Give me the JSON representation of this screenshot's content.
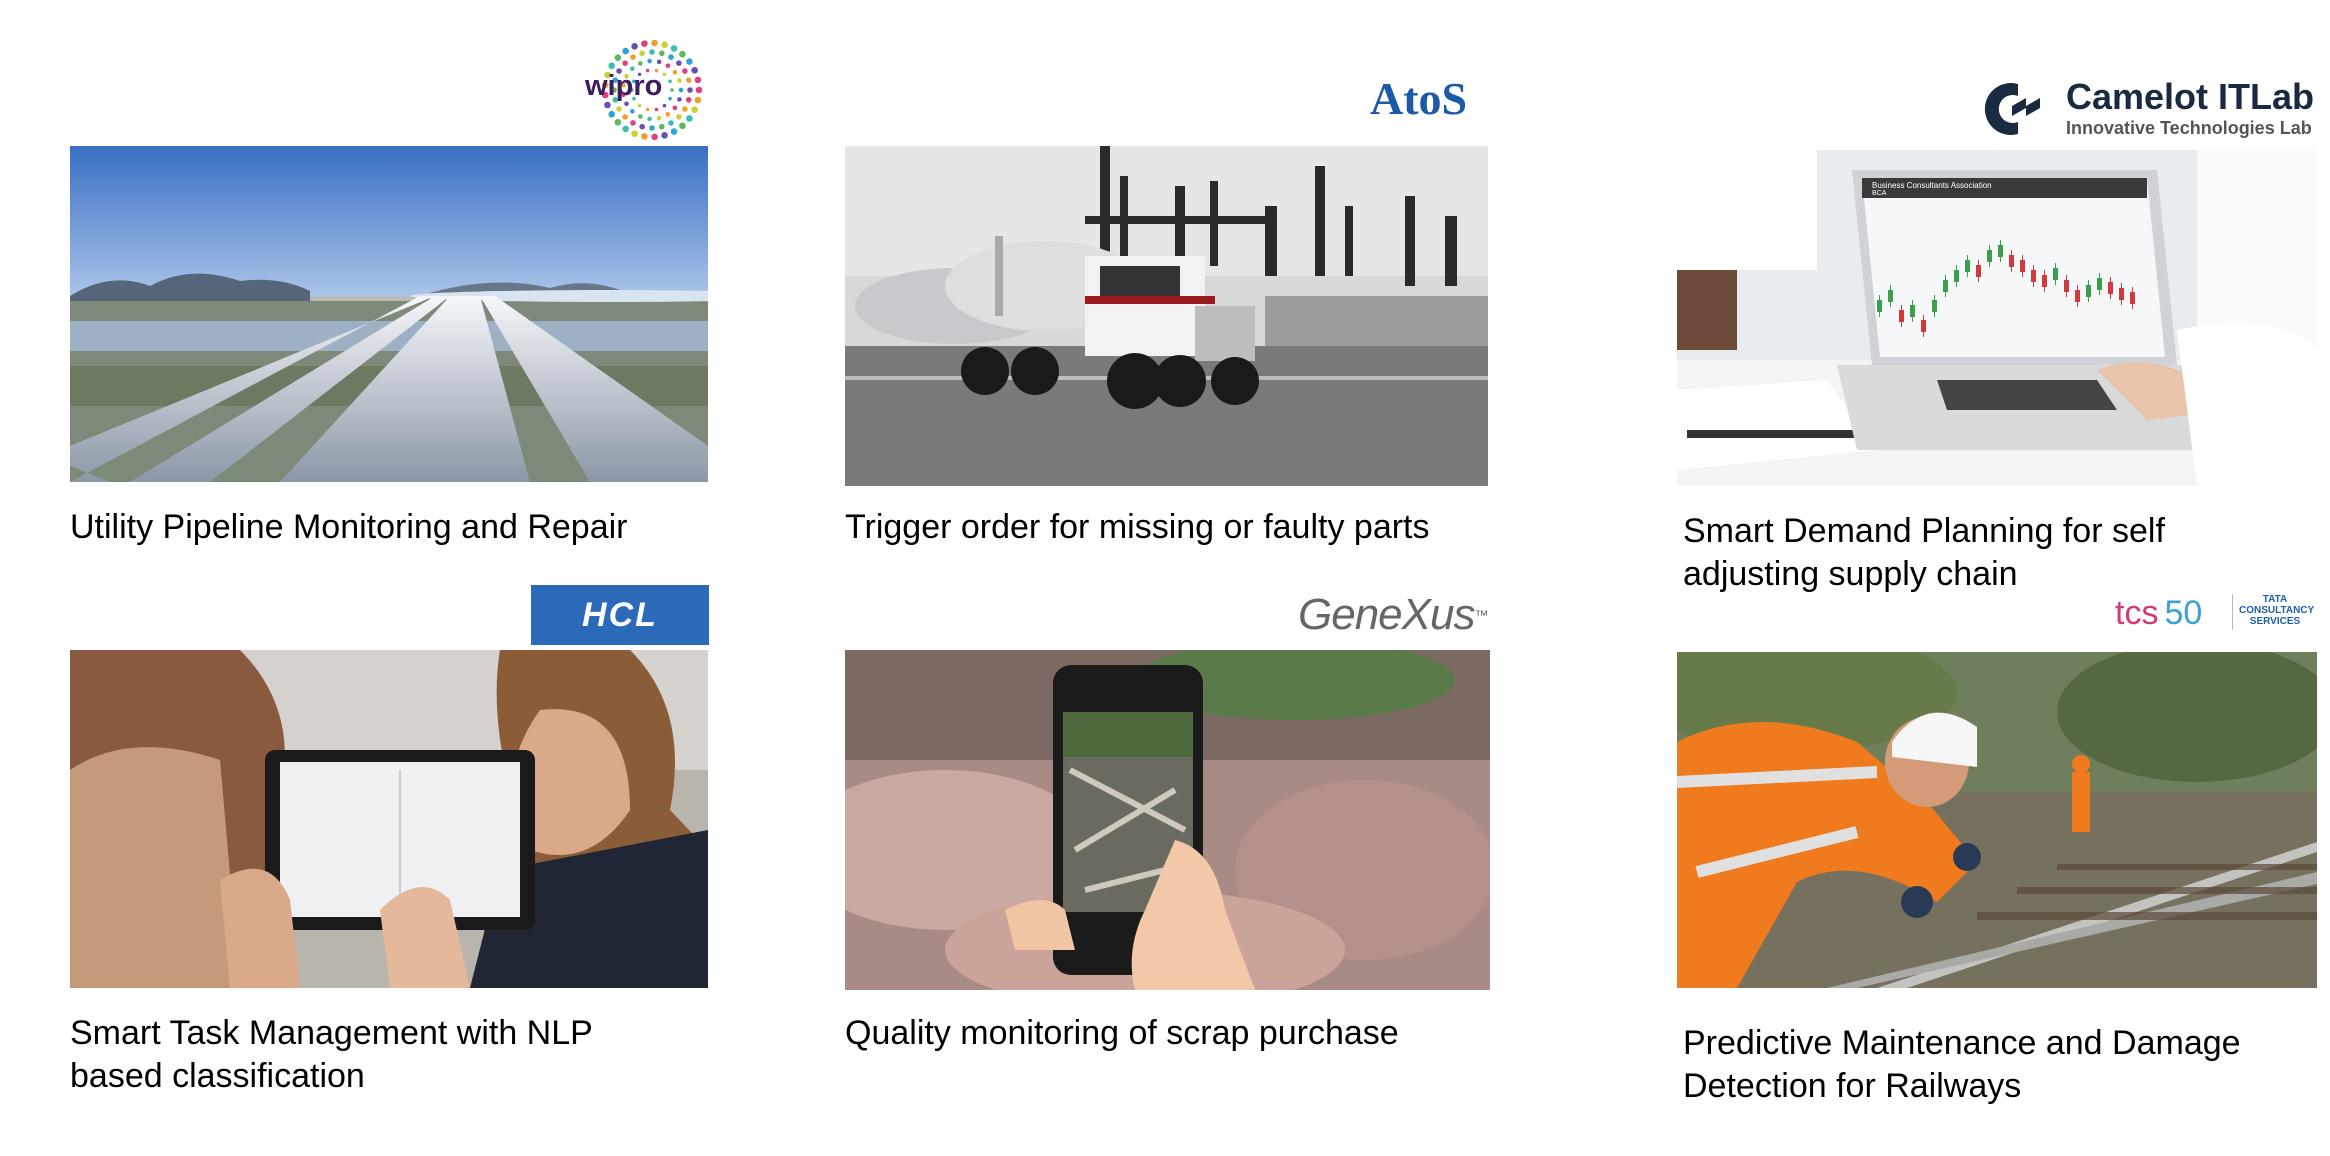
{
  "cards": [
    {
      "caption": "Utility Pipeline Monitoring and Repair",
      "logo": "wipro"
    },
    {
      "caption": "Trigger order for missing or faulty parts",
      "logo": "Atos"
    },
    {
      "caption": "Smart Demand Planning for self adjusting supply chain",
      "logo": "Camelot ITLab"
    },
    {
      "caption": "Smart Task Management with NLP based classification",
      "logo": "HCL"
    },
    {
      "caption": "Quality monitoring of scrap purchase",
      "logo": "GeneXus"
    },
    {
      "caption": "Predictive Maintenance and Damage Detection for Railways",
      "logo": "tcs 50"
    }
  ],
  "logos": {
    "wipro": "wipro",
    "atos": "AtoS",
    "camelot_name": "Camelot ITLab",
    "camelot_sub": "Innovative Technologies Lab",
    "hcl": "HCL",
    "genexus": "GeneXus",
    "genexus_tm": "™",
    "tcs": "tcs",
    "tcs_num": "50",
    "tata_line1": "TATA",
    "tata_line2": "CONSULTANCY",
    "tata_line3": "SERVICES"
  },
  "screen": {
    "chart_header": "Business Consultants Association",
    "chart_sub": "BCA"
  },
  "colors": {
    "hcl_blue": "#2a6ab8",
    "atos_blue": "#1c5aa6",
    "camelot_navy": "#1a2a40",
    "safety_orange": "#f07a1e"
  }
}
